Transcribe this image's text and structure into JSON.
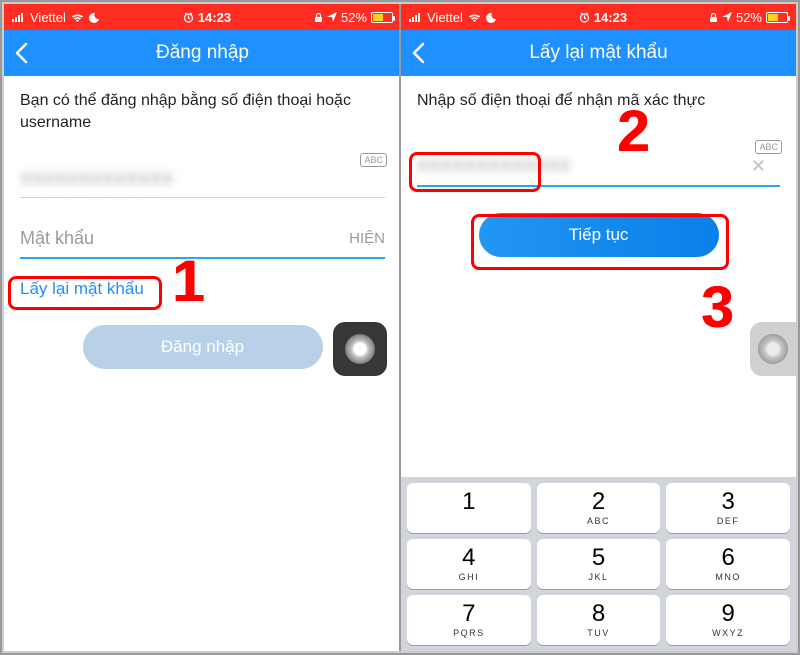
{
  "status": {
    "carrier": "Viettel",
    "time": "14:23",
    "battery_pct": "52%"
  },
  "left": {
    "title": "Đăng nhập",
    "prompt": "Bạn có thể đăng nhập bằng số điện thoại hoặc username",
    "phone_blur": "XXXXXXXXXXXXX",
    "abc": "ABC",
    "password_ph": "Mật khẩu",
    "show_label": "HIỆN",
    "forgot": "Lấy lại mật khẩu",
    "login_btn": "Đăng nhập"
  },
  "right": {
    "title": "Lấy lại mật khẩu",
    "prompt": "Nhập số điện thoại để nhận mã xác thực",
    "phone_blur": "XXXXXXXXXXXXX",
    "abc": "ABC",
    "continue_btn": "Tiếp tục"
  },
  "keypad": [
    [
      {
        "n": "1",
        "l": ""
      },
      {
        "n": "2",
        "l": "ABC"
      },
      {
        "n": "3",
        "l": "DEF"
      }
    ],
    [
      {
        "n": "4",
        "l": "GHI"
      },
      {
        "n": "5",
        "l": "JKL"
      },
      {
        "n": "6",
        "l": "MNO"
      }
    ],
    [
      {
        "n": "7",
        "l": "PQRS"
      },
      {
        "n": "8",
        "l": "TUV"
      },
      {
        "n": "9",
        "l": "WXYZ"
      }
    ]
  ],
  "annotations": {
    "n1": "1",
    "n2": "2",
    "n3": "3"
  }
}
